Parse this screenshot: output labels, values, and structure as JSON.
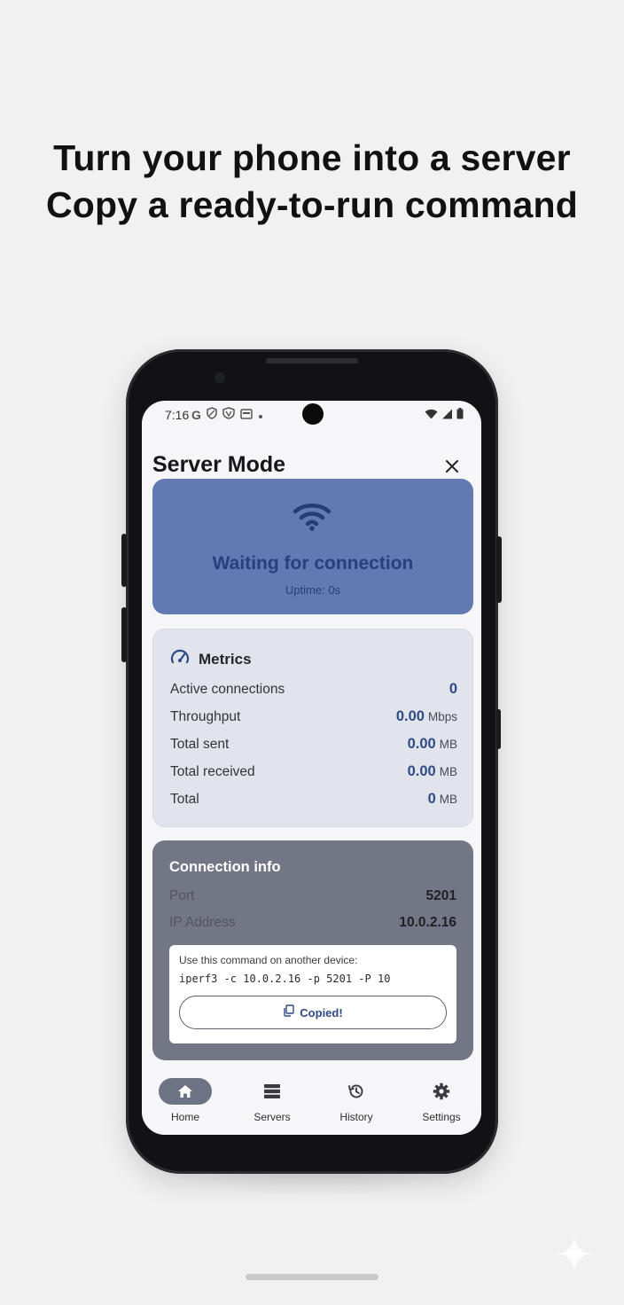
{
  "headline": {
    "line1": "Turn your phone into a server",
    "line2": "Copy a ready-to-run command"
  },
  "status_bar": {
    "time": "7:16",
    "left_icons": [
      "google-g-icon",
      "shield-icon",
      "vpn-icon",
      "card-icon",
      "dot-icon"
    ],
    "right_icons": [
      "wifi-icon",
      "signal-icon",
      "battery-icon"
    ]
  },
  "header": {
    "title": "Server Mode",
    "close_icon": "close-icon"
  },
  "status_card": {
    "icon": "wifi-icon",
    "status": "Waiting for connection",
    "uptime": "Uptime: 0s",
    "bg_color": "#6279b2"
  },
  "metrics": {
    "title": "Metrics",
    "icon": "speedometer-icon",
    "rows": [
      {
        "label": "Active connections",
        "value": "0",
        "unit": ""
      },
      {
        "label": "Throughput",
        "value": "0.00",
        "unit": "Mbps"
      },
      {
        "label": "Total sent",
        "value": "0.00",
        "unit": "MB"
      },
      {
        "label": "Total received",
        "value": "0.00",
        "unit": "MB"
      },
      {
        "label": "Total",
        "value": "0",
        "unit": "MB"
      }
    ]
  },
  "connection_info": {
    "title": "Connection info",
    "port_label": "Port",
    "port_value": "5201",
    "ip_label": "IP Address",
    "ip_value": "10.0.2.16",
    "command_label": "Use this command on another device:",
    "command": "iperf3 -c 10.0.2.16 -p 5201 -P 10",
    "copy_button": "Copied!"
  },
  "bottom_nav": {
    "items": [
      {
        "label": "Home",
        "icon": "home-icon",
        "active": true
      },
      {
        "label": "Servers",
        "icon": "servers-icon",
        "active": false
      },
      {
        "label": "History",
        "icon": "history-icon",
        "active": false
      },
      {
        "label": "Settings",
        "icon": "gear-icon",
        "active": false
      }
    ]
  }
}
